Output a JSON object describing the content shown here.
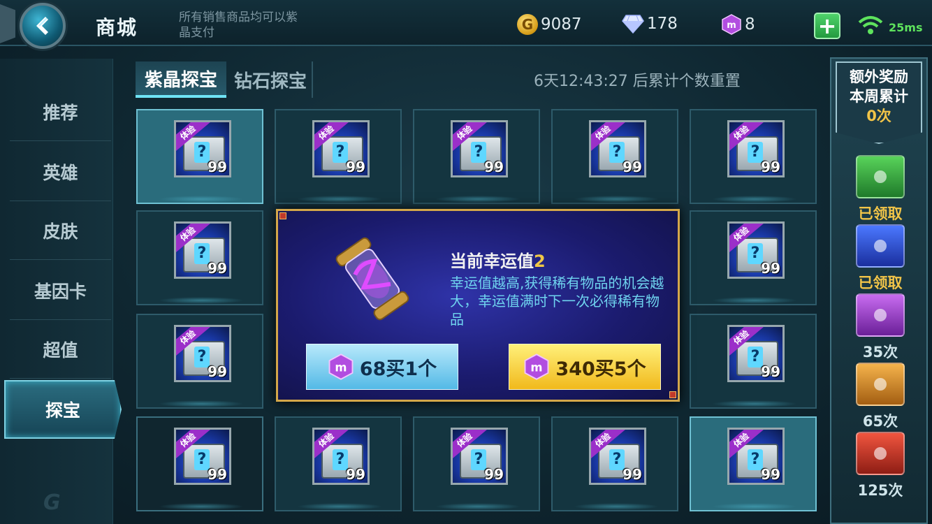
{
  "topbar": {
    "title": "商城",
    "note": "所有销售商品均可以紫晶支付",
    "gold": "9087",
    "diamonds": "178",
    "amethyst": "8",
    "ping": "25ms",
    "icons": [
      "back-arrow-icon",
      "gold-coin-icon",
      "diamond-icon",
      "amethyst-icon",
      "plus-icon",
      "wifi-icon"
    ]
  },
  "sidebar": {
    "items": [
      {
        "label": "推荐"
      },
      {
        "label": "英雄"
      },
      {
        "label": "皮肤"
      },
      {
        "label": "基因卡"
      },
      {
        "label": "超值"
      },
      {
        "label": "探宝"
      }
    ],
    "active": "探宝"
  },
  "tabs": [
    {
      "label": "紫晶探宝",
      "active": true
    },
    {
      "label": "钻石探宝",
      "active": false
    }
  ],
  "timer": "6天12:43:27 后累计个数重置",
  "grid": {
    "ribbon": "体验",
    "quantity": "99"
  },
  "popup": {
    "luck_title": "当前幸运值",
    "luck_value": "2",
    "luck_desc": "幸运值越高,获得稀有物品的机会越大，幸运值满时下一次必得稀有物品",
    "buy_one": "68买1个",
    "buy_five": "340买5个"
  },
  "rewards": {
    "header_line1": "额外奖励",
    "header_line2": "本周累计",
    "header_count": "0次",
    "items": [
      {
        "label": "已领取",
        "color": "#3fae3a"
      },
      {
        "label": "已领取",
        "color": "#2a52d9"
      },
      {
        "label": "35次",
        "color": "#a73fd6"
      },
      {
        "label": "65次",
        "color": "#e0912a"
      },
      {
        "label": "125次",
        "color": "#d23a2a"
      }
    ]
  },
  "colors": {
    "accent": "#6fe3f5",
    "gold_text": "#f2c548",
    "popup_border": "#d4a74a"
  }
}
